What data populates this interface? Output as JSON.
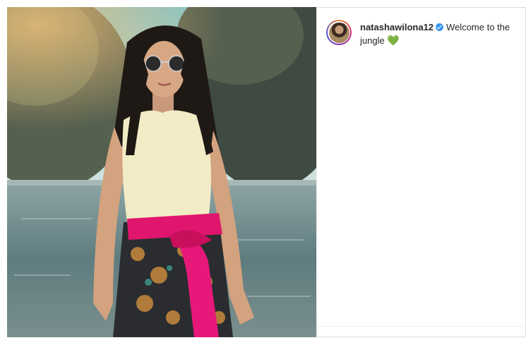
{
  "post": {
    "username": "natashawilona12",
    "caption": "Welcome to the jungle",
    "emoji": "💚",
    "verified": true,
    "icons": {
      "verified": "verified-badge-icon",
      "avatar": "profile-avatar"
    },
    "colors": {
      "verified": "#3897f0",
      "heart": "#2bb52b",
      "text": "#262626"
    }
  }
}
